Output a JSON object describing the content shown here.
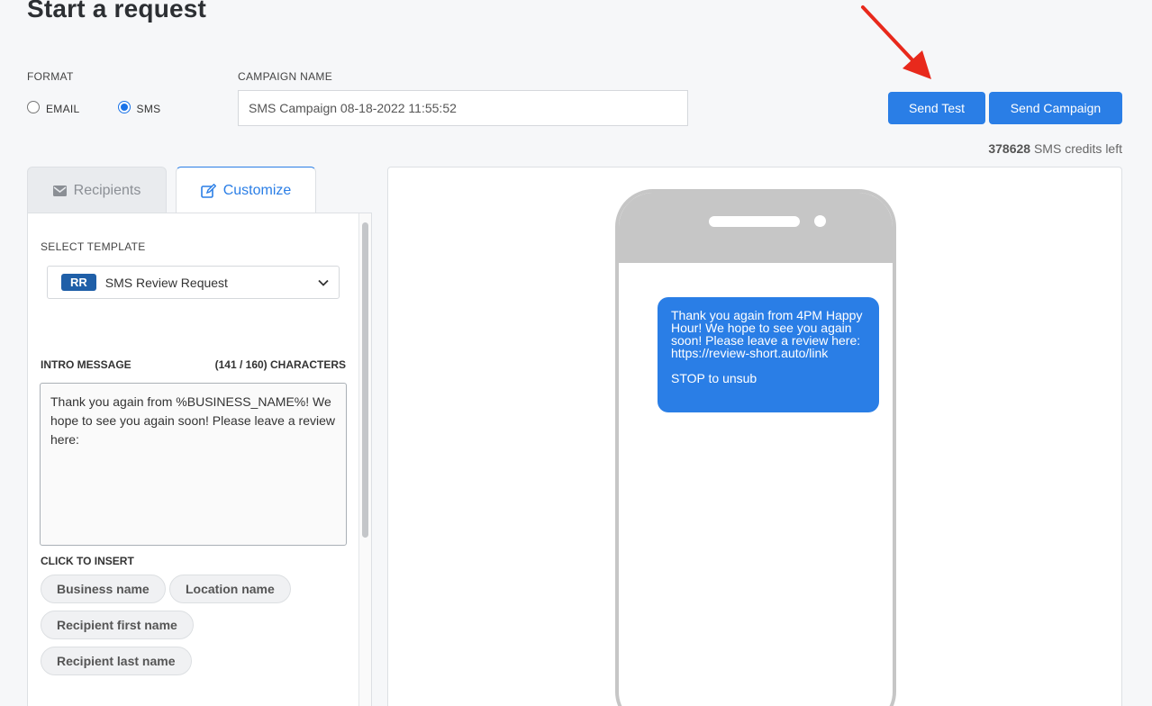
{
  "page": {
    "title": "Start a request"
  },
  "format": {
    "label": "FORMAT",
    "options": [
      {
        "label": "EMAIL",
        "selected": false
      },
      {
        "label": "SMS",
        "selected": true
      }
    ]
  },
  "campaign": {
    "label": "CAMPAIGN NAME",
    "value": "SMS Campaign 08-18-2022 11:55:52"
  },
  "actions": {
    "send_test": "Send Test",
    "send_campaign": "Send Campaign"
  },
  "credits": {
    "count": "378628",
    "text": "SMS credits left"
  },
  "tabs": [
    {
      "label": "Recipients",
      "icon": "envelope-icon",
      "active": false
    },
    {
      "label": "Customize",
      "icon": "edit-icon",
      "active": true
    }
  ],
  "customize": {
    "select_template_label": "SELECT TEMPLATE",
    "template_badge": "RR",
    "template_name": "SMS Review Request",
    "intro_label": "INTRO MESSAGE",
    "char_count": "(141 / 160) CHARACTERS",
    "intro_text": "Thank you again from %BUSINESS_NAME%! We hope to see you again soon! Please leave a review here:",
    "insert_label": "CLICK TO INSERT",
    "chips": [
      "Business name",
      "Location name",
      "Recipient first name",
      "Recipient last name"
    ]
  },
  "preview": {
    "message": "Thank you again from 4PM Happy Hour! We hope to see you again soon! Please leave a review here: https://review-short.auto/link",
    "stop_text": "STOP to unsub"
  },
  "colors": {
    "accent": "#2a7ee6",
    "badge": "#1f5fa8",
    "annotation_arrow": "#e8291c"
  }
}
